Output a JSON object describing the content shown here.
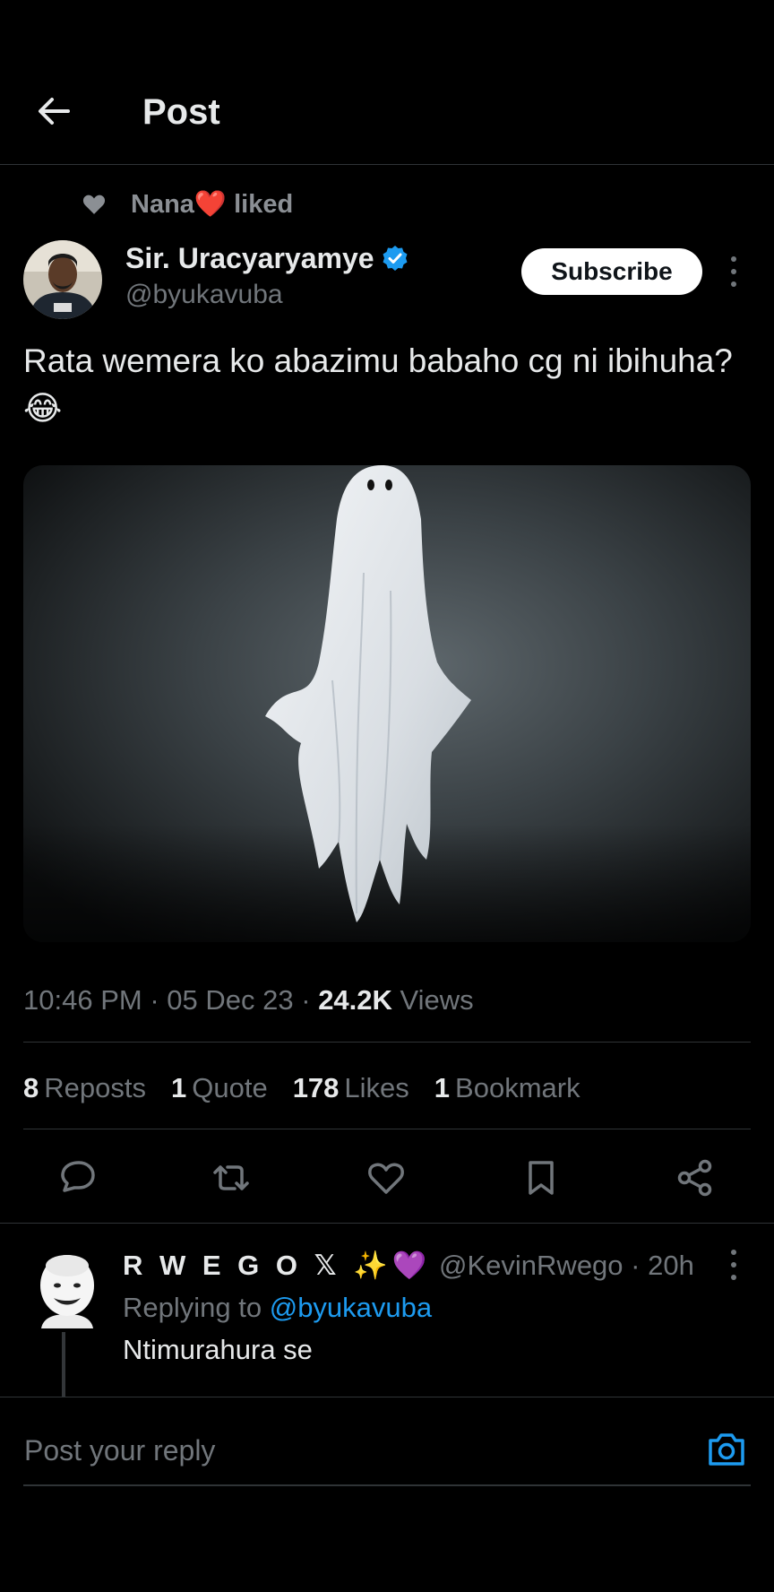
{
  "header": {
    "title": "Post",
    "back_icon": "arrow-left-icon"
  },
  "social_context": {
    "user": "Nana",
    "emoji": "❤️",
    "action": "liked"
  },
  "post": {
    "author_name": "Sir. Uracyaryamye",
    "verified": true,
    "handle": "@byukavuba",
    "subscribe_label": "Subscribe",
    "text": "Rata wemera ko abazimu babaho cg ni ibihuha?😂",
    "media_alt": "ghost under white sheet",
    "time": "10:46 PM",
    "date": "05 Dec 23",
    "views_count": "24.2K",
    "views_label": "Views",
    "sep": "·"
  },
  "stats": [
    {
      "count": "8",
      "label": "Reposts"
    },
    {
      "count": "1",
      "label": "Quote"
    },
    {
      "count": "178",
      "label": "Likes"
    },
    {
      "count": "1",
      "label": "Bookmark"
    }
  ],
  "actions": [
    "reply-icon",
    "repost-icon",
    "like-icon",
    "bookmark-icon",
    "share-icon"
  ],
  "reply": {
    "author_name": "R W E G O 𝕏 ✨💜",
    "handle_time": "@KevinRwego · 20h",
    "replying_prefix": "Replying to",
    "replying_handle": "@byukavuba",
    "text": "Ntimurahura se"
  },
  "composer": {
    "placeholder": "Post your reply",
    "camera_icon": "camera-icon"
  },
  "colors": {
    "background": "#000000",
    "accent": "#1d9bf0",
    "muted": "#71767b",
    "divider": "#2f3336"
  }
}
